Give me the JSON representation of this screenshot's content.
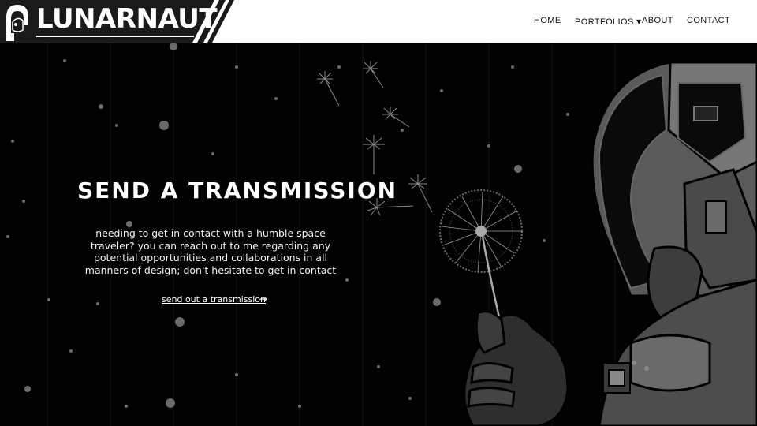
{
  "brand": {
    "name": "LUNARNAUT"
  },
  "nav": {
    "home": "HOME",
    "portfolios": "PORTFOLIOS",
    "portfolios_caret": "▾",
    "about": "ABOUT",
    "contact": "CONTACT"
  },
  "hero": {
    "title": "SEND A TRANSMISSION",
    "body": "needing to get in contact with a humble space traveler? you can reach out to me regarding any potential opportunities and collaborations in all manners of design; don't hesitate to get in contact",
    "cta_label": "send out a transmission",
    "cta_arrow": "→"
  },
  "icons": {
    "logo": "astronaut-helmet-icon",
    "arrow": "arrow-right-icon",
    "caret": "chevron-down-icon"
  },
  "colors": {
    "header_bg": "#ffffff",
    "hero_bg": "#020202",
    "text_light": "#ffffff",
    "nav_text": "#111111",
    "illustration_gray": "#5a5a5a"
  }
}
